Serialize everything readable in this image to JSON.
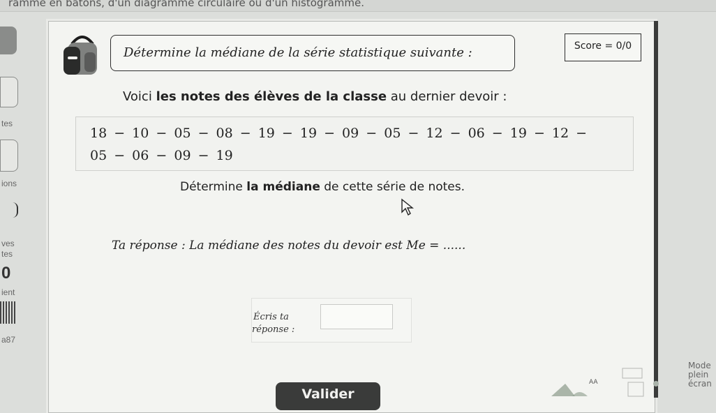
{
  "top_text": "ramme en bâtons, d'un diagramme circulaire ou d'un histogramme.",
  "sidebar": {
    "labels": [
      "tes",
      "ions",
      "ves",
      "tes",
      "ient",
      "a87"
    ],
    "big_value": "0"
  },
  "exercise": {
    "instruction": "Détermine la médiane de la série statistique suivante :",
    "score": "Score = 0/0",
    "intro_plain": "Voici ",
    "intro_bold": "les notes des élèves de la classe",
    "intro_rest": " au dernier devoir :",
    "data_line1": "18 − 10 − 05 − 08 − 19 − 19 − 09 − 05 − 12 − 06 − 19 − 12 −",
    "data_line2": "05 − 06 − 09 − 19",
    "task_plain": "Détermine ",
    "task_bold": "la médiane",
    "task_rest": " de cette série de notes.",
    "answer_prompt": "Ta réponse : La médiane des notes du devoir est Me = ......",
    "input_label_line1": "Écris ta",
    "input_label_line2": "réponse :",
    "input_value": "",
    "submit_label": "Valider"
  },
  "fullscreen": {
    "line1": "Mode",
    "line2": "plein",
    "line3": "écran"
  },
  "colors": {
    "card_bg": "#f3f4f1",
    "button_bg": "#3a3b3a",
    "text": "#222222"
  }
}
